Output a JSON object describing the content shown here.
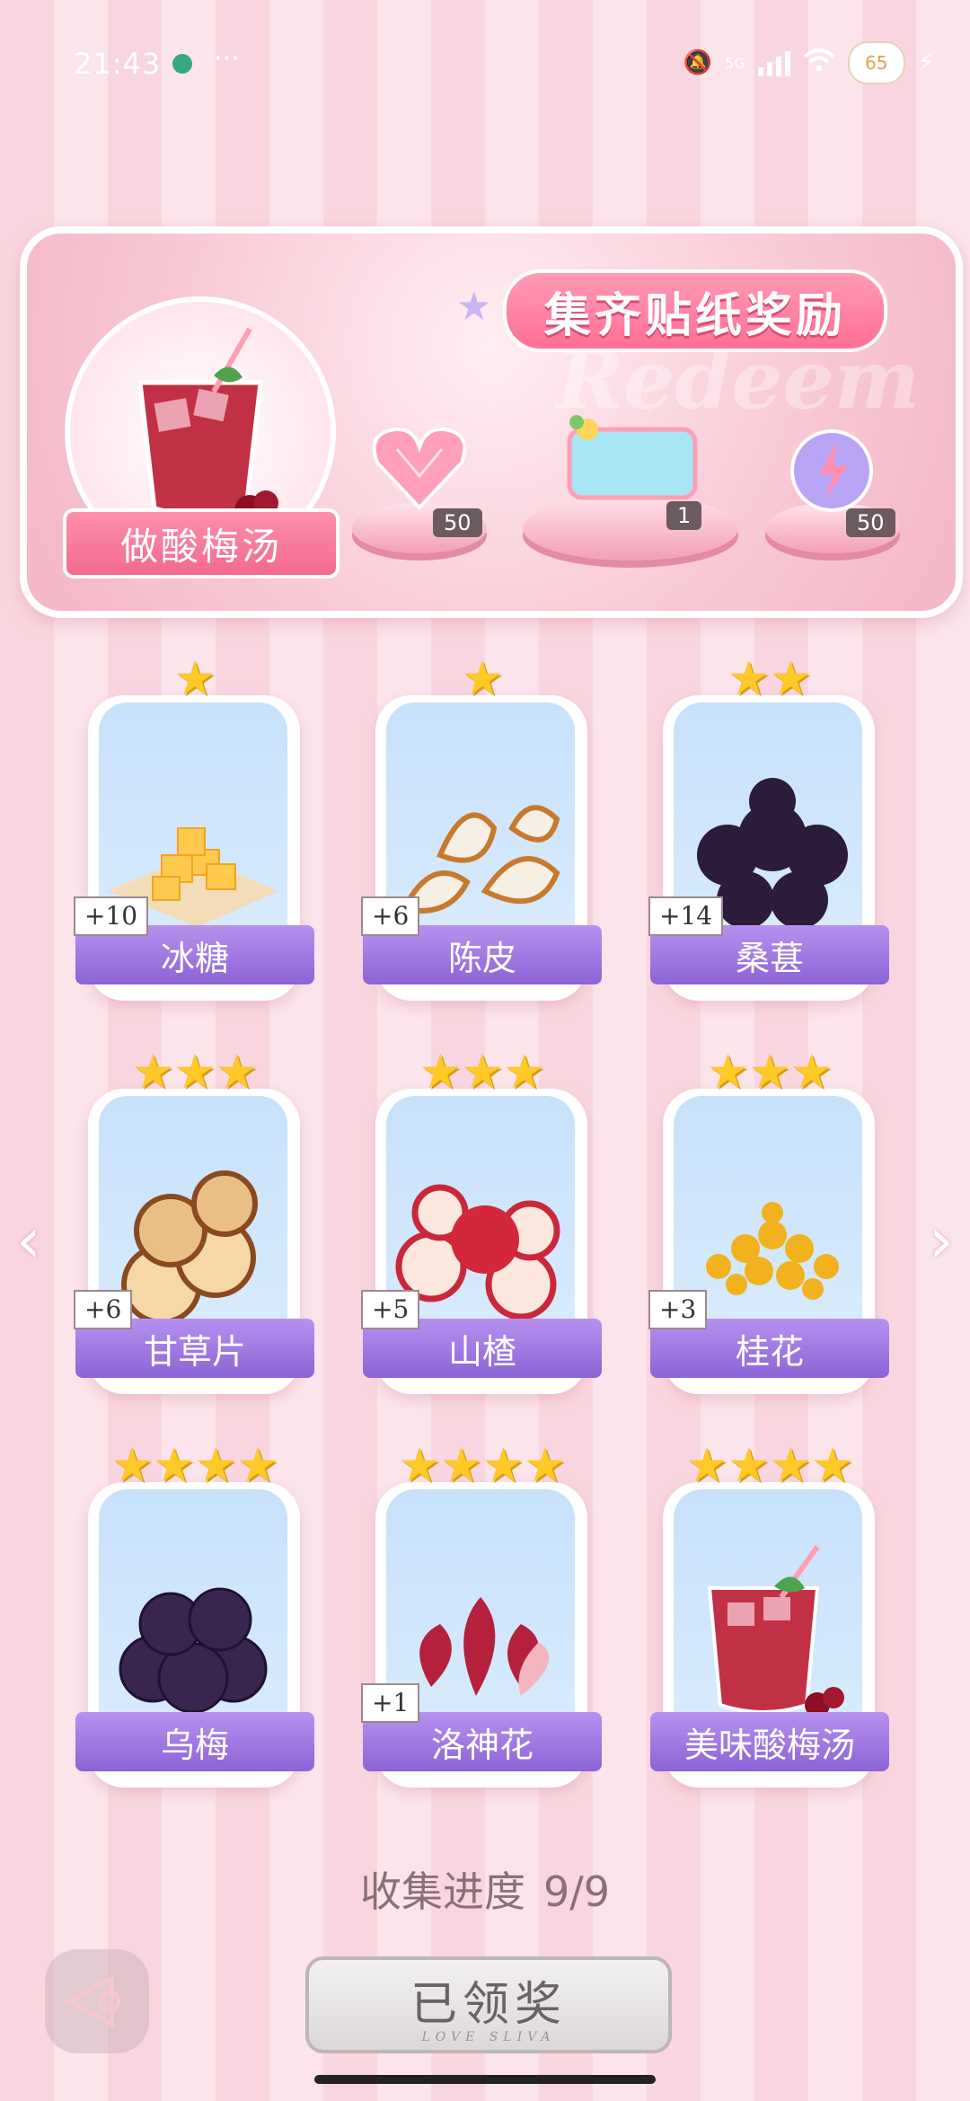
{
  "status_bar": {
    "time": "21:43",
    "more": "···",
    "network": "5G",
    "battery": "65"
  },
  "banner": {
    "title": "集齐贴纸奖励",
    "watermark": "Redeem",
    "drink_label": "做酸梅汤",
    "rewards": [
      {
        "name": "heart-gem",
        "count": "50"
      },
      {
        "name": "drink-sticker-card",
        "count": "1"
      },
      {
        "name": "energy-orb",
        "count": "50"
      }
    ]
  },
  "cards": [
    {
      "name": "冰糖",
      "plus": "+10",
      "stars": 1,
      "art": "rock-sugar"
    },
    {
      "name": "陈皮",
      "plus": "+6",
      "stars": 1,
      "art": "orange-peel"
    },
    {
      "name": "桑葚",
      "plus": "+14",
      "stars": 2,
      "art": "mulberry"
    },
    {
      "name": "甘草片",
      "plus": "+6",
      "stars": 3,
      "art": "licorice"
    },
    {
      "name": "山楂",
      "plus": "+5",
      "stars": 3,
      "art": "hawthorn"
    },
    {
      "name": "桂花",
      "plus": "+3",
      "stars": 3,
      "art": "osmanthus"
    },
    {
      "name": "乌梅",
      "plus": "",
      "stars": 4,
      "art": "smoked-plum"
    },
    {
      "name": "洛神花",
      "plus": "+1",
      "stars": 4,
      "art": "roselle"
    },
    {
      "name": "美味酸梅汤",
      "plus": "",
      "stars": 4,
      "art": "plum-drink"
    }
  ],
  "progress": {
    "label": "收集进度",
    "value": "9/9"
  },
  "buttons": {
    "claimed": "已领奖",
    "claimed_sub": "LOVE SLIVA"
  },
  "colors": {
    "card_label": "#8b64d6",
    "star": "#ffc928",
    "banner_ribbon": "#ff6f96"
  }
}
